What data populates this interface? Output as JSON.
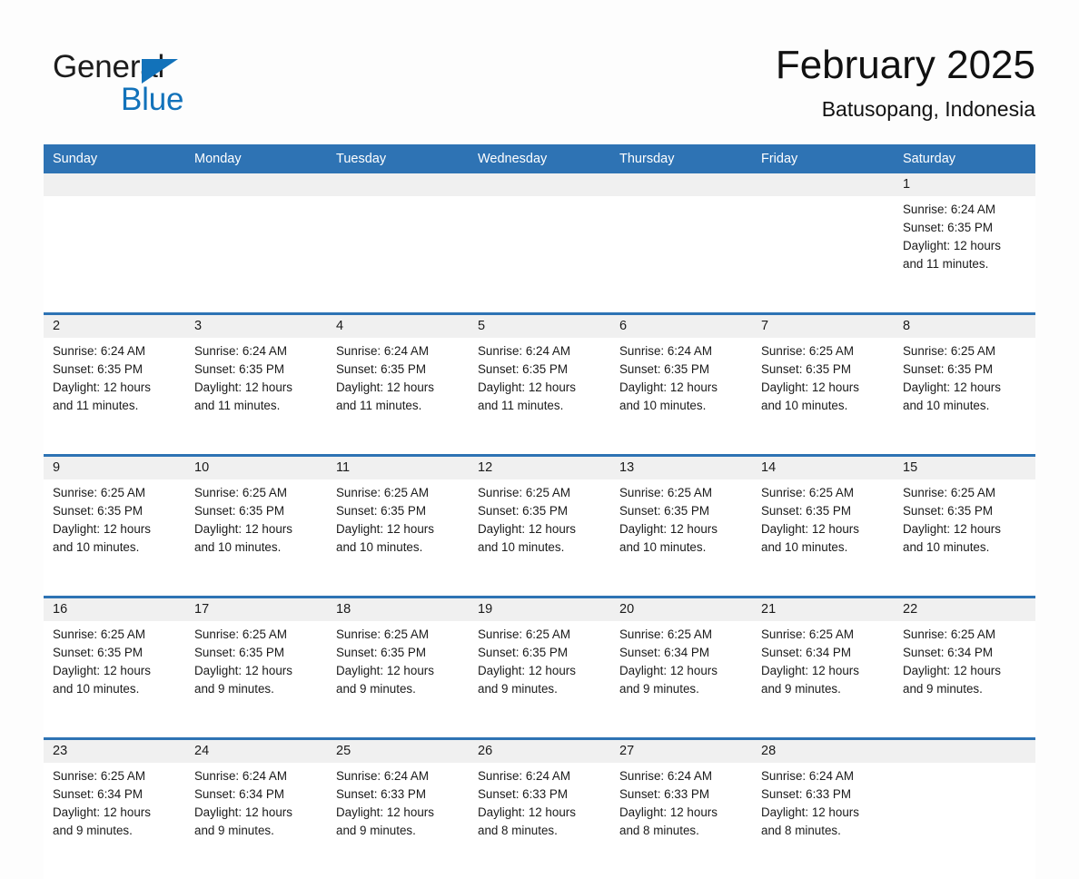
{
  "brand": {
    "name_top": "General",
    "name_bottom": "Blue",
    "accent_color": "#1272BA",
    "triangle_icon": "triangle-right-icon"
  },
  "header": {
    "title": "February 2025",
    "subtitle": "Batusopang, Indonesia"
  },
  "theme": {
    "header_blue": "#2E73B4",
    "daynum_gray": "#f0f0f0",
    "page_background": "#fdfdfd",
    "text_color": "#1a1a1a"
  },
  "calendar": {
    "weekday_headers": [
      "Sunday",
      "Monday",
      "Tuesday",
      "Wednesday",
      "Thursday",
      "Friday",
      "Saturday"
    ],
    "labels": {
      "sunrise_prefix": "Sunrise:",
      "sunset_prefix": "Sunset:",
      "daylight_prefix": "Daylight:"
    },
    "weeks": [
      {
        "days": [
          {
            "day": "",
            "lines": [
              "",
              "",
              "",
              ""
            ]
          },
          {
            "day": "",
            "lines": [
              "",
              "",
              "",
              ""
            ]
          },
          {
            "day": "",
            "lines": [
              "",
              "",
              "",
              ""
            ]
          },
          {
            "day": "",
            "lines": [
              "",
              "",
              "",
              ""
            ]
          },
          {
            "day": "",
            "lines": [
              "",
              "",
              "",
              ""
            ]
          },
          {
            "day": "",
            "lines": [
              "",
              "",
              "",
              ""
            ]
          },
          {
            "day": "1",
            "lines": [
              "Sunrise: 6:24 AM",
              "Sunset: 6:35 PM",
              "Daylight: 12 hours",
              "and 11 minutes."
            ]
          }
        ]
      },
      {
        "days": [
          {
            "day": "2",
            "lines": [
              "Sunrise: 6:24 AM",
              "Sunset: 6:35 PM",
              "Daylight: 12 hours",
              "and 11 minutes."
            ]
          },
          {
            "day": "3",
            "lines": [
              "Sunrise: 6:24 AM",
              "Sunset: 6:35 PM",
              "Daylight: 12 hours",
              "and 11 minutes."
            ]
          },
          {
            "day": "4",
            "lines": [
              "Sunrise: 6:24 AM",
              "Sunset: 6:35 PM",
              "Daylight: 12 hours",
              "and 11 minutes."
            ]
          },
          {
            "day": "5",
            "lines": [
              "Sunrise: 6:24 AM",
              "Sunset: 6:35 PM",
              "Daylight: 12 hours",
              "and 11 minutes."
            ]
          },
          {
            "day": "6",
            "lines": [
              "Sunrise: 6:24 AM",
              "Sunset: 6:35 PM",
              "Daylight: 12 hours",
              "and 10 minutes."
            ]
          },
          {
            "day": "7",
            "lines": [
              "Sunrise: 6:25 AM",
              "Sunset: 6:35 PM",
              "Daylight: 12 hours",
              "and 10 minutes."
            ]
          },
          {
            "day": "8",
            "lines": [
              "Sunrise: 6:25 AM",
              "Sunset: 6:35 PM",
              "Daylight: 12 hours",
              "and 10 minutes."
            ]
          }
        ]
      },
      {
        "days": [
          {
            "day": "9",
            "lines": [
              "Sunrise: 6:25 AM",
              "Sunset: 6:35 PM",
              "Daylight: 12 hours",
              "and 10 minutes."
            ]
          },
          {
            "day": "10",
            "lines": [
              "Sunrise: 6:25 AM",
              "Sunset: 6:35 PM",
              "Daylight: 12 hours",
              "and 10 minutes."
            ]
          },
          {
            "day": "11",
            "lines": [
              "Sunrise: 6:25 AM",
              "Sunset: 6:35 PM",
              "Daylight: 12 hours",
              "and 10 minutes."
            ]
          },
          {
            "day": "12",
            "lines": [
              "Sunrise: 6:25 AM",
              "Sunset: 6:35 PM",
              "Daylight: 12 hours",
              "and 10 minutes."
            ]
          },
          {
            "day": "13",
            "lines": [
              "Sunrise: 6:25 AM",
              "Sunset: 6:35 PM",
              "Daylight: 12 hours",
              "and 10 minutes."
            ]
          },
          {
            "day": "14",
            "lines": [
              "Sunrise: 6:25 AM",
              "Sunset: 6:35 PM",
              "Daylight: 12 hours",
              "and 10 minutes."
            ]
          },
          {
            "day": "15",
            "lines": [
              "Sunrise: 6:25 AM",
              "Sunset: 6:35 PM",
              "Daylight: 12 hours",
              "and 10 minutes."
            ]
          }
        ]
      },
      {
        "days": [
          {
            "day": "16",
            "lines": [
              "Sunrise: 6:25 AM",
              "Sunset: 6:35 PM",
              "Daylight: 12 hours",
              "and 10 minutes."
            ]
          },
          {
            "day": "17",
            "lines": [
              "Sunrise: 6:25 AM",
              "Sunset: 6:35 PM",
              "Daylight: 12 hours",
              "and 9 minutes."
            ]
          },
          {
            "day": "18",
            "lines": [
              "Sunrise: 6:25 AM",
              "Sunset: 6:35 PM",
              "Daylight: 12 hours",
              "and 9 minutes."
            ]
          },
          {
            "day": "19",
            "lines": [
              "Sunrise: 6:25 AM",
              "Sunset: 6:35 PM",
              "Daylight: 12 hours",
              "and 9 minutes."
            ]
          },
          {
            "day": "20",
            "lines": [
              "Sunrise: 6:25 AM",
              "Sunset: 6:34 PM",
              "Daylight: 12 hours",
              "and 9 minutes."
            ]
          },
          {
            "day": "21",
            "lines": [
              "Sunrise: 6:25 AM",
              "Sunset: 6:34 PM",
              "Daylight: 12 hours",
              "and 9 minutes."
            ]
          },
          {
            "day": "22",
            "lines": [
              "Sunrise: 6:25 AM",
              "Sunset: 6:34 PM",
              "Daylight: 12 hours",
              "and 9 minutes."
            ]
          }
        ]
      },
      {
        "days": [
          {
            "day": "23",
            "lines": [
              "Sunrise: 6:25 AM",
              "Sunset: 6:34 PM",
              "Daylight: 12 hours",
              "and 9 minutes."
            ]
          },
          {
            "day": "24",
            "lines": [
              "Sunrise: 6:24 AM",
              "Sunset: 6:34 PM",
              "Daylight: 12 hours",
              "and 9 minutes."
            ]
          },
          {
            "day": "25",
            "lines": [
              "Sunrise: 6:24 AM",
              "Sunset: 6:33 PM",
              "Daylight: 12 hours",
              "and 9 minutes."
            ]
          },
          {
            "day": "26",
            "lines": [
              "Sunrise: 6:24 AM",
              "Sunset: 6:33 PM",
              "Daylight: 12 hours",
              "and 8 minutes."
            ]
          },
          {
            "day": "27",
            "lines": [
              "Sunrise: 6:24 AM",
              "Sunset: 6:33 PM",
              "Daylight: 12 hours",
              "and 8 minutes."
            ]
          },
          {
            "day": "28",
            "lines": [
              "Sunrise: 6:24 AM",
              "Sunset: 6:33 PM",
              "Daylight: 12 hours",
              "and 8 minutes."
            ]
          },
          {
            "day": "",
            "lines": [
              "",
              "",
              "",
              ""
            ]
          }
        ]
      }
    ]
  }
}
